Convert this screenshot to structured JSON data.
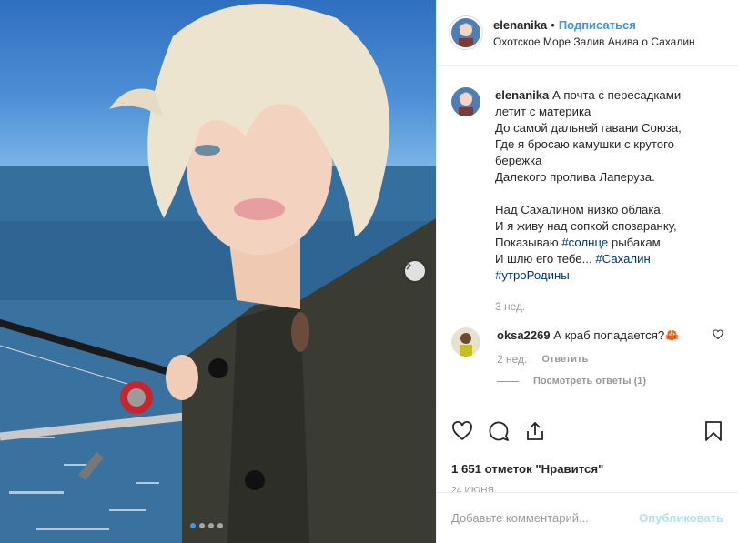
{
  "post": {
    "carousel": {
      "total_slides": 4,
      "active_slide": 1
    }
  },
  "header": {
    "username": "elenanika",
    "separator": "•",
    "follow_label": "Подписаться",
    "location": "Охотское Море Залив Анива о Сахалин"
  },
  "caption": {
    "username": "elenanika",
    "lines": [
      "А почта с пересадками",
      "летит с материка",
      "До самой дальней гавани Союза,",
      "Где я бросаю камушки с крутого",
      "бережка",
      "Далекого пролива Лаперуза.",
      "",
      "Над Сахалином низко облака,",
      "И я живу над сопкой спозаранку,",
      "Показываю",
      "#солнце",
      "рыбакам",
      "И шлю его тебе...",
      "#Сахалин",
      "#утроРодины"
    ],
    "time": "3 нед."
  },
  "comment": {
    "username": "oksa2269",
    "text": "А краб попадается?🦀",
    "time": "2 нед.",
    "reply_label": "Ответить",
    "view_replies_label": "Посмотреть ответы (1)"
  },
  "actions": {
    "icons": [
      "heart-icon",
      "comment-icon",
      "share-icon",
      "bookmark-icon"
    ],
    "likes_text": "1 651 отметок \"Нравится\"",
    "date": "24 ИЮНЯ"
  },
  "add_comment": {
    "placeholder": "Добавьте комментарий...",
    "publish_label": "Опубликовать"
  },
  "colors": {
    "link": "#3897f0",
    "hashtag": "#003569",
    "muted": "#999999",
    "border": "#efefef",
    "publish_disabled": "#b2dffc"
  }
}
